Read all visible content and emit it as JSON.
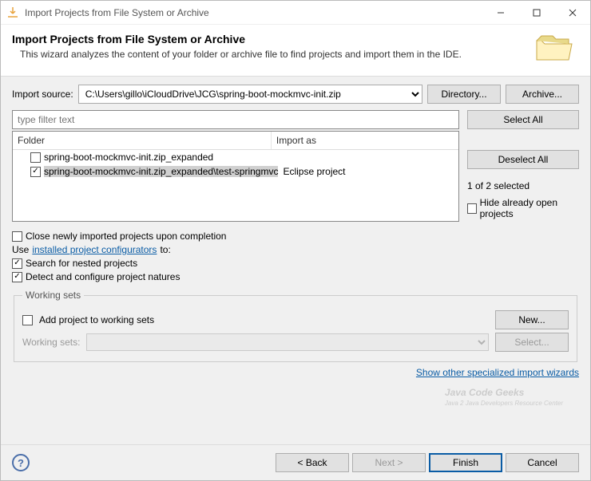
{
  "window": {
    "title": "Import Projects from File System or Archive"
  },
  "banner": {
    "title": "Import Projects from File System or Archive",
    "desc": "This wizard analyzes the content of your folder or archive file to find projects and import them in the IDE."
  },
  "source": {
    "label": "Import source:",
    "value": "C:\\Users\\gillo\\iCloudDrive\\JCG\\spring-boot-mockmvc-init.zip",
    "directory_btn": "Directory...",
    "archive_btn": "Archive..."
  },
  "filter": {
    "placeholder": "type filter text"
  },
  "table": {
    "col_folder": "Folder",
    "col_import": "Import as",
    "rows": [
      {
        "checked": false,
        "name": "spring-boot-mockmvc-init.zip_expanded",
        "import_as": "",
        "selected": false
      },
      {
        "checked": true,
        "name": "spring-boot-mockmvc-init.zip_expanded\\test-springmvc",
        "import_as": "Eclipse project",
        "selected": true
      }
    ]
  },
  "side": {
    "select_all": "Select All",
    "deselect_all": "Deselect All",
    "status": "1 of 2 selected",
    "hide_open": "Hide already open projects"
  },
  "options": {
    "close_newly": "Close newly imported projects upon completion",
    "use_prefix": "Use ",
    "use_link": "installed project configurators",
    "use_suffix": " to:",
    "search_nested": "Search for nested projects",
    "detect_natures": "Detect and configure project natures"
  },
  "workingsets": {
    "legend": "Working sets",
    "add_label": "Add project to working sets",
    "new_btn": "New...",
    "ws_label": "Working sets:",
    "select_btn": "Select..."
  },
  "special_link": "Show other specialized import wizards",
  "watermark": {
    "main": "Java Code Geeks",
    "sub": "Java 2 Java Developers Resource Center"
  },
  "footer": {
    "back": "< Back",
    "next": "Next >",
    "finish": "Finish",
    "cancel": "Cancel"
  }
}
